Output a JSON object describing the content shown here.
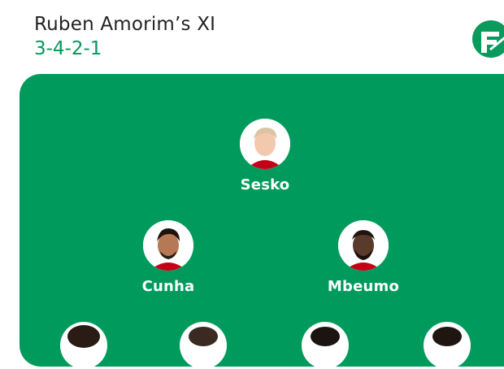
{
  "header": {
    "title": "Ruben Amorim’s XI",
    "formation": "3-4-2-1"
  },
  "brand": {
    "logo_icon": "footballco-logo-icon",
    "color": "#0a9a5c"
  },
  "pitch": {
    "color": "#009b5c"
  },
  "lineup": {
    "striker": {
      "name": "Sesko"
    },
    "attacking_mids": [
      {
        "name": "Cunha"
      },
      {
        "name": "Mbeumo"
      }
    ],
    "midfield_row_partial": [
      "player-1",
      "player-2",
      "player-3",
      "player-4"
    ]
  }
}
